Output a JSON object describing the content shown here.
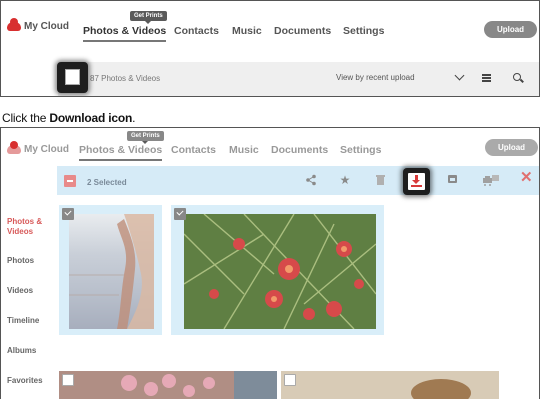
{
  "panel1": {
    "logo_text": "My Cloud",
    "nav": [
      "Photos & Videos",
      "Contacts",
      "Music",
      "Documents",
      "Settings"
    ],
    "get_prints_badge": "Get Prints",
    "upload_label": "Upload",
    "selection_text": "87 Photos & Videos",
    "view_by_label": "View by recent upload"
  },
  "instruction": {
    "prefix": "Click the ",
    "target": "Download icon",
    "suffix": "."
  },
  "panel2": {
    "logo_text": "My Cloud",
    "nav": [
      "Photos & Videos",
      "Contacts",
      "Music",
      "Documents",
      "Settings"
    ],
    "get_prints_badge": "Get Prints",
    "upload_label": "Upload",
    "selected_text": "2 Selected",
    "close_glyph": "✕",
    "sidebar": [
      "Photos & Videos",
      "Photos",
      "Videos",
      "Timeline",
      "Albums",
      "Favorites"
    ]
  },
  "colors": {
    "brand_red": "#d82f2f",
    "selection_bar": "#d6ebf7",
    "active_sidebar": "#d85a5a",
    "download_red": "#d83a3a"
  },
  "icons": {
    "logo": "cloud-logo-icon",
    "list_view": "list-view-icon",
    "search": "search-icon",
    "share": "share-icon",
    "favorite": "star-icon",
    "delete": "trash-icon",
    "download": "download-icon",
    "image": "image-icon",
    "print": "print-icon",
    "close": "close-icon"
  }
}
